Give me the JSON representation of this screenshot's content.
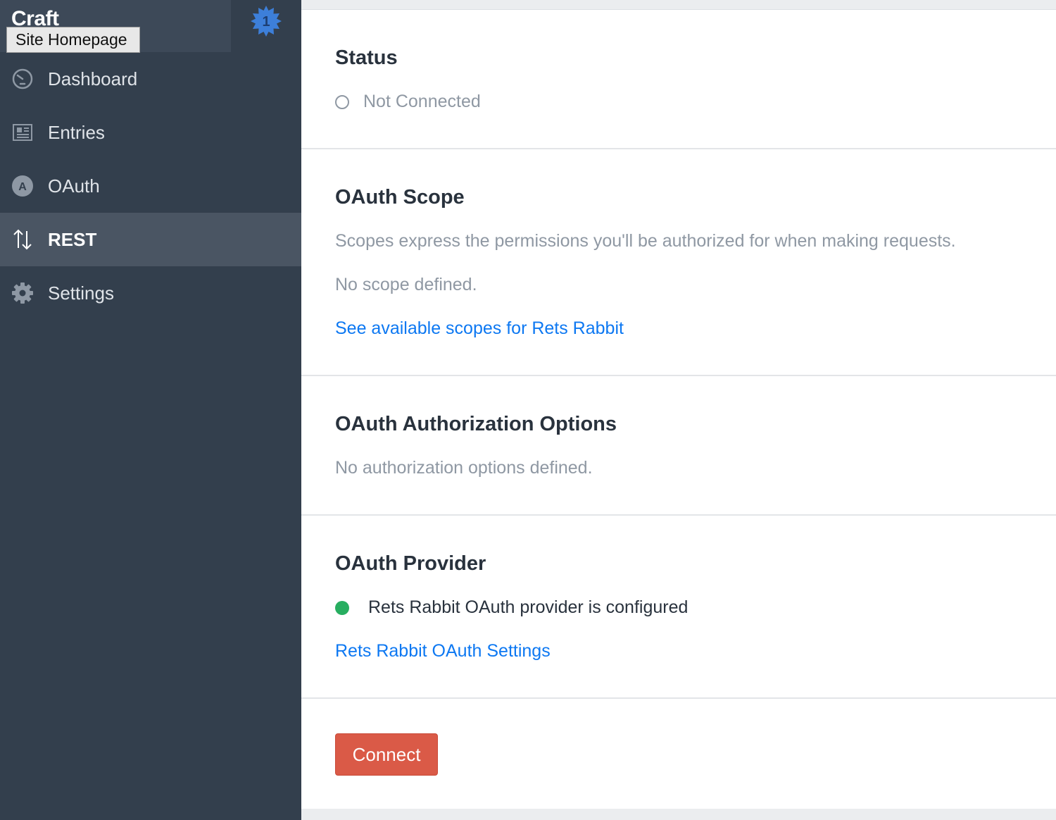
{
  "sidebar": {
    "site_name": "Craft",
    "tooltip": "Site Homepage",
    "badge_count": "1",
    "badge_color": "#3d7fd9",
    "items": [
      {
        "label": "Dashboard",
        "icon": "gauge-icon"
      },
      {
        "label": "Entries",
        "icon": "newspaper-icon"
      },
      {
        "label": "OAuth",
        "icon": "oauth-icon",
        "icon_text": "A"
      },
      {
        "label": "REST",
        "icon": "up-down-arrows-icon",
        "selected": true
      },
      {
        "label": "Settings",
        "icon": "gear-icon"
      }
    ]
  },
  "main": {
    "status": {
      "title": "Status",
      "value": "Not Connected"
    },
    "scope": {
      "title": "OAuth Scope",
      "description": "Scopes express the permissions you'll be authorized for when making requests.",
      "empty": "No scope defined.",
      "link": "See available scopes for Rets Rabbit"
    },
    "authorization": {
      "title": "OAuth Authorization Options",
      "empty": "No authorization options defined."
    },
    "provider": {
      "title": "OAuth Provider",
      "status": "Rets Rabbit OAuth provider is configured",
      "status_color": "#27ae60",
      "link": "Rets Rabbit OAuth Settings"
    },
    "connect_label": "Connect",
    "connect_color": "#da5a47",
    "link_color": "#0d78f2"
  }
}
